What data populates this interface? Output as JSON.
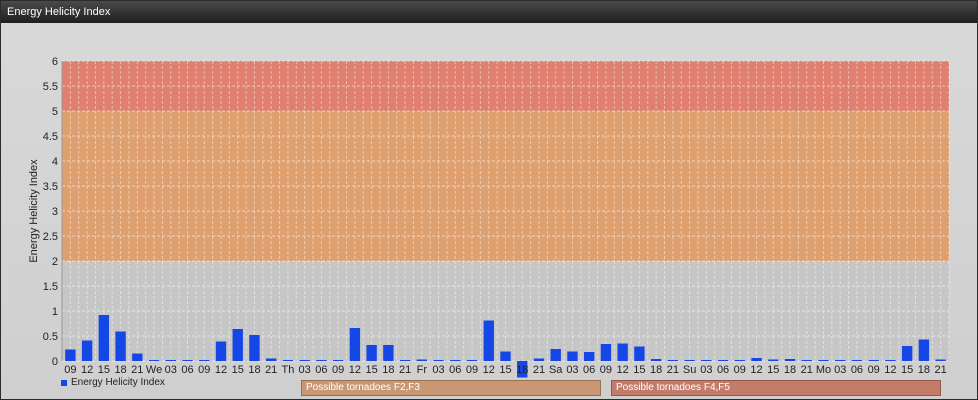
{
  "window": {
    "title": "Energy Helicity Index"
  },
  "zones": [
    {
      "label": "Possible tornadoes F2,F3",
      "color": "#c89874",
      "border": "#9a7050"
    },
    {
      "label": "Possible tornadoes F4,F5",
      "color": "#c47c6a",
      "border": "#95574a"
    }
  ],
  "chart_data": {
    "type": "bar",
    "title": "",
    "xlabel": "",
    "ylabel": "Energy Helicity Index",
    "ylim": [
      0,
      6
    ],
    "yticks": [
      0,
      0.5,
      1,
      1.5,
      2,
      2.5,
      3,
      3.5,
      4,
      4.5,
      5,
      5.5,
      6
    ],
    "grid": true,
    "legend_position": "bottom-left",
    "bands": [
      {
        "from": 0,
        "to": 2,
        "color": "#c6c6c6"
      },
      {
        "from": 2,
        "to": 5,
        "color": "#dfa070"
      },
      {
        "from": 5,
        "to": 6,
        "color": "#e08070"
      }
    ],
    "bar_color": "#1547e6",
    "categories": [
      "09",
      "12",
      "15",
      "18",
      "21",
      "We",
      "03",
      "06",
      "09",
      "12",
      "15",
      "18",
      "21",
      "Th",
      "03",
      "06",
      "09",
      "12",
      "15",
      "18",
      "21",
      "Fr",
      "03",
      "06",
      "09",
      "12",
      "15",
      "18",
      "21",
      "Sa",
      "03",
      "06",
      "09",
      "12",
      "15",
      "18",
      "21",
      "Su",
      "03",
      "06",
      "09",
      "12",
      "15",
      "18",
      "21",
      "Mo",
      "03",
      "06",
      "09",
      "12",
      "15",
      "18",
      "21"
    ],
    "series": [
      {
        "name": "Energy Helicity Index",
        "values": [
          0.23,
          0.41,
          0.92,
          0.59,
          0.15,
          0.02,
          0.02,
          0.02,
          0.02,
          0.39,
          0.64,
          0.52,
          0.05,
          0.02,
          0.02,
          0.02,
          0.02,
          0.66,
          0.32,
          0.32,
          0.02,
          0.03,
          0.02,
          0.02,
          0.02,
          0.81,
          0.19,
          -0.33,
          0.05,
          0.24,
          0.19,
          0.18,
          0.34,
          0.35,
          0.29,
          0.04,
          0.02,
          0.02,
          0.02,
          0.02,
          0.02,
          0.06,
          0.03,
          0.04,
          0.02,
          0.02,
          0.02,
          0.02,
          0.02,
          0.02,
          0.3,
          0.43,
          0.03
        ]
      }
    ]
  }
}
